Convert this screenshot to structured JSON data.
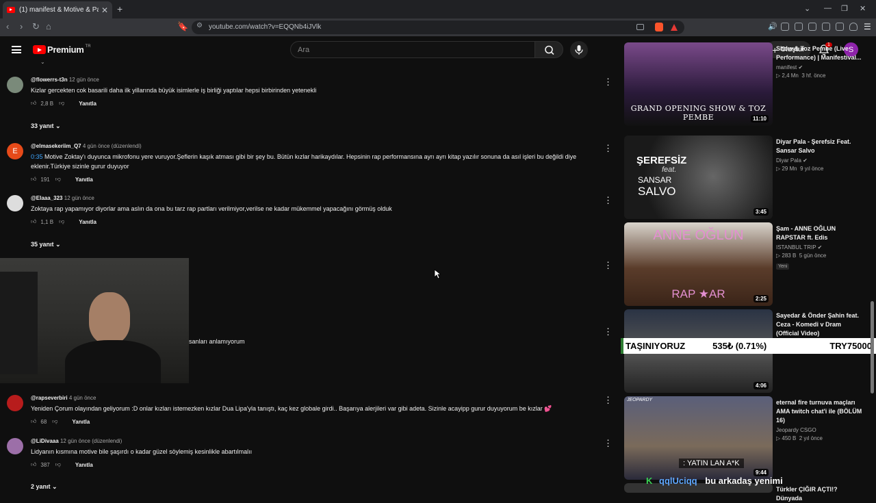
{
  "browser": {
    "tab_title": "(1) manifest & Motive & Pango",
    "tab_close": "✕",
    "new_tab": "+",
    "url": "youtube.com/watch?v=EQQNb4iJVlk"
  },
  "header": {
    "logo_text": "Premium",
    "logo_region": "TR",
    "search_placeholder": "Ara",
    "create_label": "Oluştur",
    "notification_count": "1",
    "avatar_letter": "S"
  },
  "comments": [
    {
      "handle": "@flowerrs-t3n",
      "time": "12 gün önce",
      "text": "Kizlar gercekten cok basarili daha ilk yillarında büyük isimlerle iş birliği yaptılar hepsi birbirinden yetenekli",
      "likes": "2,8 B",
      "reply": "Yanıtla",
      "replies": "33 yanıt",
      "avatar_color": "#7a8a7a"
    },
    {
      "handle": "@elmasekeriim_Q7",
      "time": "4 gün önce (düzenlendi)",
      "timestamp": "0:35",
      "text": "Motive Zoktay'ı duyunca mikrofonu yere vuruyor.Şeflerin kaşık atması gibi bir şey bu. Bütün kızlar harikaydılar. Hepsinin rap performansına ayrı ayrı kitap yazılır sonuna da asıl işleri bu değildi diye eklenir.Türkiye sizinle gurur duyuyor",
      "likes": "191",
      "reply": "Yanıtla",
      "avatar_letter": "E",
      "avatar_color": "#e64a19"
    },
    {
      "handle": "@Elaaa_323",
      "time": "12 gün önce",
      "text": "Zoktaya rap yapamıyor diyorlar ama aslın da ona bu tarz rap partları verilmiyor,verilse ne kadar mükemmel yapacağını görmüş olduk",
      "likes": "1,1 B",
      "reply": "Yanıtla",
      "replies": "35 yanıt",
      "avatar_color": "#dddddd"
    },
    {
      "partial_text": "sanları anlamıyorum"
    },
    {
      "handle": "@rapseverbiri",
      "time": "4 gün önce",
      "text": "Yeniden Çorum olayından geliyorum :D onlar kızları istemezken kızlar Dua Lipa'yla tanıştı, kaç kez globale girdi.. Başarıya alerjileri var gibi adeta. Sizinle acayipp gurur duyuyorum be kızlar 💕",
      "likes": "68",
      "reply": "Yanıtla",
      "avatar_color": "#b71c1c"
    },
    {
      "handle": "@LiDivaaa",
      "time": "12 gün önce (düzenlendi)",
      "text": "Lidyanın kısmına motive bile şaşırdı o kadar güzel söylemiş kesinlikle abartılmalıı",
      "likes": "387",
      "reply": "Yanıtla",
      "replies": "2 yanıt",
      "avatar_color": "#9c6fa8"
    }
  ],
  "sidebar_videos": [
    {
      "title": "Show & Toz Pembe (Live Performance) | Manifestival...",
      "channel": "manifest",
      "views": "2,4 Mn",
      "age": "3 hf. önce",
      "duration": "11:10",
      "thumb_text": "GRAND OPENING SHOW & TOZ PEMBE"
    },
    {
      "title": "Diyar Pala - Şerefsiz Feat. Sansar Salvo",
      "channel": "Diyar Pala",
      "views": "29 Mn",
      "age": "9 yıl önce",
      "duration": "3:45",
      "thumb_text_1": "ŞEREFSİZ",
      "thumb_text_2": "feat.",
      "thumb_text_3": "SANSAR",
      "thumb_text_4": "SALVO"
    },
    {
      "title": "Şam - ANNE OĞLUN RAPSTAR ft. Edis",
      "channel": "ISTANBUL TRIP",
      "views": "283 B",
      "age": "5 gün önce",
      "badge": "Yeni",
      "duration": "2:25",
      "thumb_text_1": "ANNE OĞLUN",
      "thumb_text_2": "RAP ★AR"
    },
    {
      "title": "Sayedar & Önder Şahin feat. Ceza - Komedi v Dram (Official Video)",
      "duration": "4:06"
    },
    {
      "title": "eternal fire turnuva maçları AMA twitch chat'i ile (BÖLÜM 16)",
      "channel": "Jeopardy CSGO",
      "views": "450 B",
      "age": "2 yıl önce",
      "duration": "9:44",
      "thumb_text": "JEOPARDY",
      "thumb_caption": ": YATIN LAN A*K"
    },
    {
      "title": "Türkler ÇIĞIR AÇTI!? Dünyada"
    }
  ],
  "ticker": {
    "label": "TAŞINIYORUZ",
    "change": "535₺ (0.71%)",
    "value": "TRY75000"
  },
  "chat_overlay": {
    "user": "qqlUciqq",
    "message": "bu arkadaş yenimi"
  }
}
